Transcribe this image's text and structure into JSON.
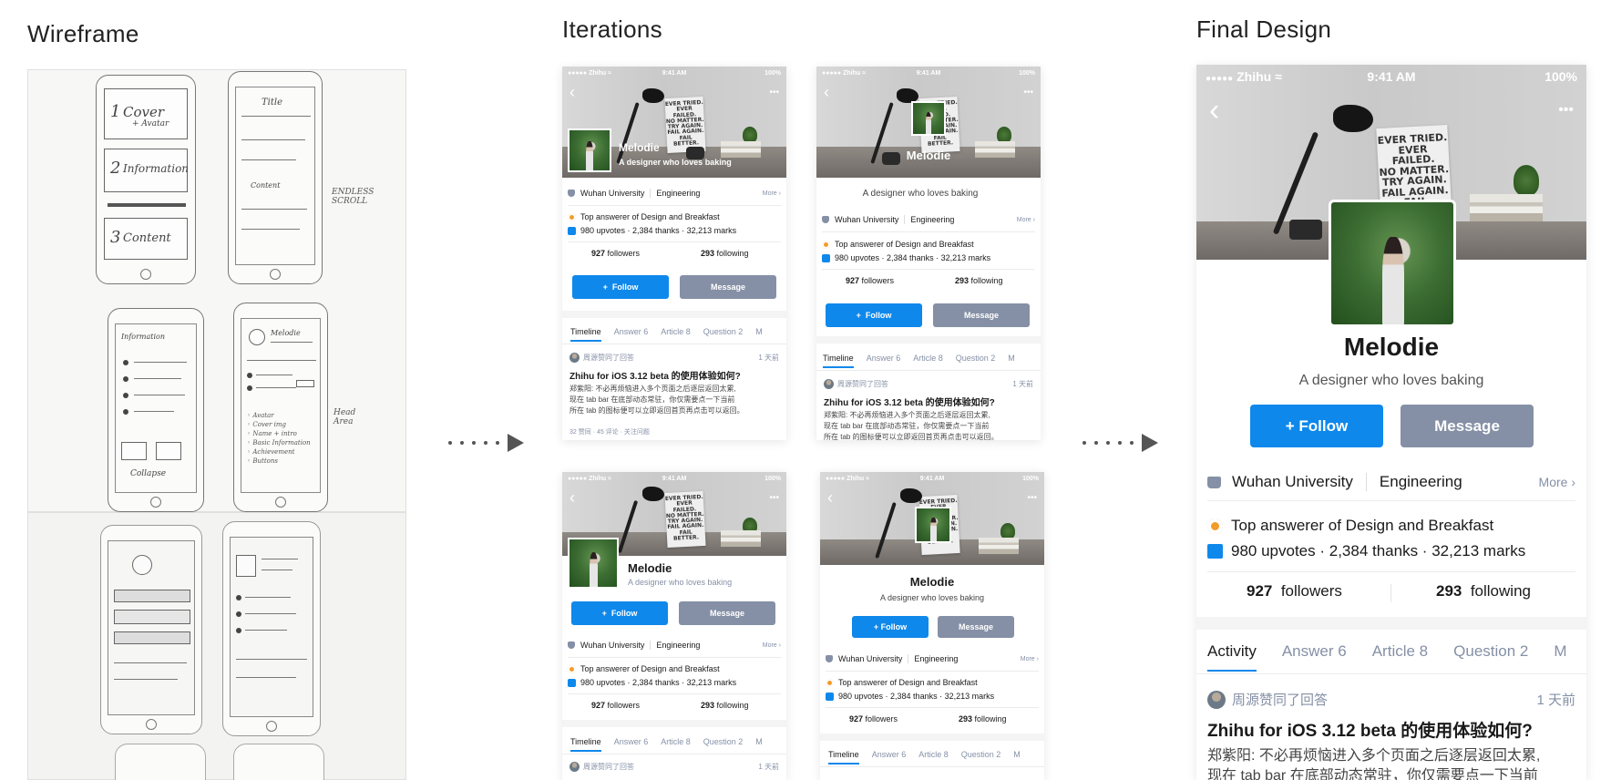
{
  "sections": {
    "wireframe": "Wireframe",
    "iterations": "Iterations",
    "final": "Final Design"
  },
  "wireframe": {
    "labels": {
      "cover": "Cover",
      "cover_sub": "+ Avatar",
      "information": "Information",
      "content": "Content",
      "title": "Title",
      "endless": "ENDLESS SCROLL",
      "melodie": "Melodie",
      "collapse": "Collapse",
      "head_area": "Head Area",
      "checklist": [
        "Avatar",
        "Cover img",
        "Name + intro",
        "Basic Information",
        "Achievement",
        "Buttons"
      ]
    }
  },
  "profile": {
    "status_dots": "●●●●●",
    "carrier": "Zhihu",
    "wifi": "≈",
    "time": "9:41 AM",
    "battery": "100%",
    "back": "‹",
    "more": "•••",
    "poster_lines": [
      "EVER TRIED.",
      "EVER FAILED.",
      "NO MATTER.",
      "TRY AGAIN.",
      "FAIL AGAIN.",
      "FAIL BETTER."
    ],
    "name": "Melodie",
    "bio": "A designer who loves baking",
    "follow": "+ Follow",
    "follow_plain": "Follow",
    "follow_plus": "+",
    "message": "Message",
    "school": "Wuhan University",
    "major": "Engineering",
    "more_link": "More",
    "achievement": "Top answerer of Design and Breakfast",
    "stats_line": "980 upvotes · 2,384 thanks · 32,213 marks",
    "followers_count": "927",
    "followers_label": "followers",
    "following_count": "293",
    "following_label": "following",
    "tabs_iter": [
      "Timeline",
      "Answer 6",
      "Article 8",
      "Question 2",
      "M"
    ],
    "tabs_final": [
      "Activity",
      "Answer 6",
      "Article 8",
      "Question 2",
      "M"
    ],
    "feed": {
      "actor": "周源赞同了回答",
      "time": "1 天前",
      "question": "Zhihu for iOS 3.12 beta 的使用体验如何?",
      "excerpt_1": "郑紫阳: 不必再烦恼进入多个页面之后逐层返回太累,",
      "excerpt_2": "现在 tab bar 在底部动态常驻，你仅需要点一下当前",
      "excerpt_3": "所在 tab 的图标便可以立即返回首页再点击可以返回。",
      "excerpt_final_2": "现在 tab bar 在底部动态常驻，你仅需要点一下当前",
      "meta": "32 赞同 · 45 评论 · 关注问题"
    }
  },
  "colors": {
    "accent": "#0f88eb",
    "secondary_button": "#8590a6",
    "badge": "#f29c2b"
  }
}
